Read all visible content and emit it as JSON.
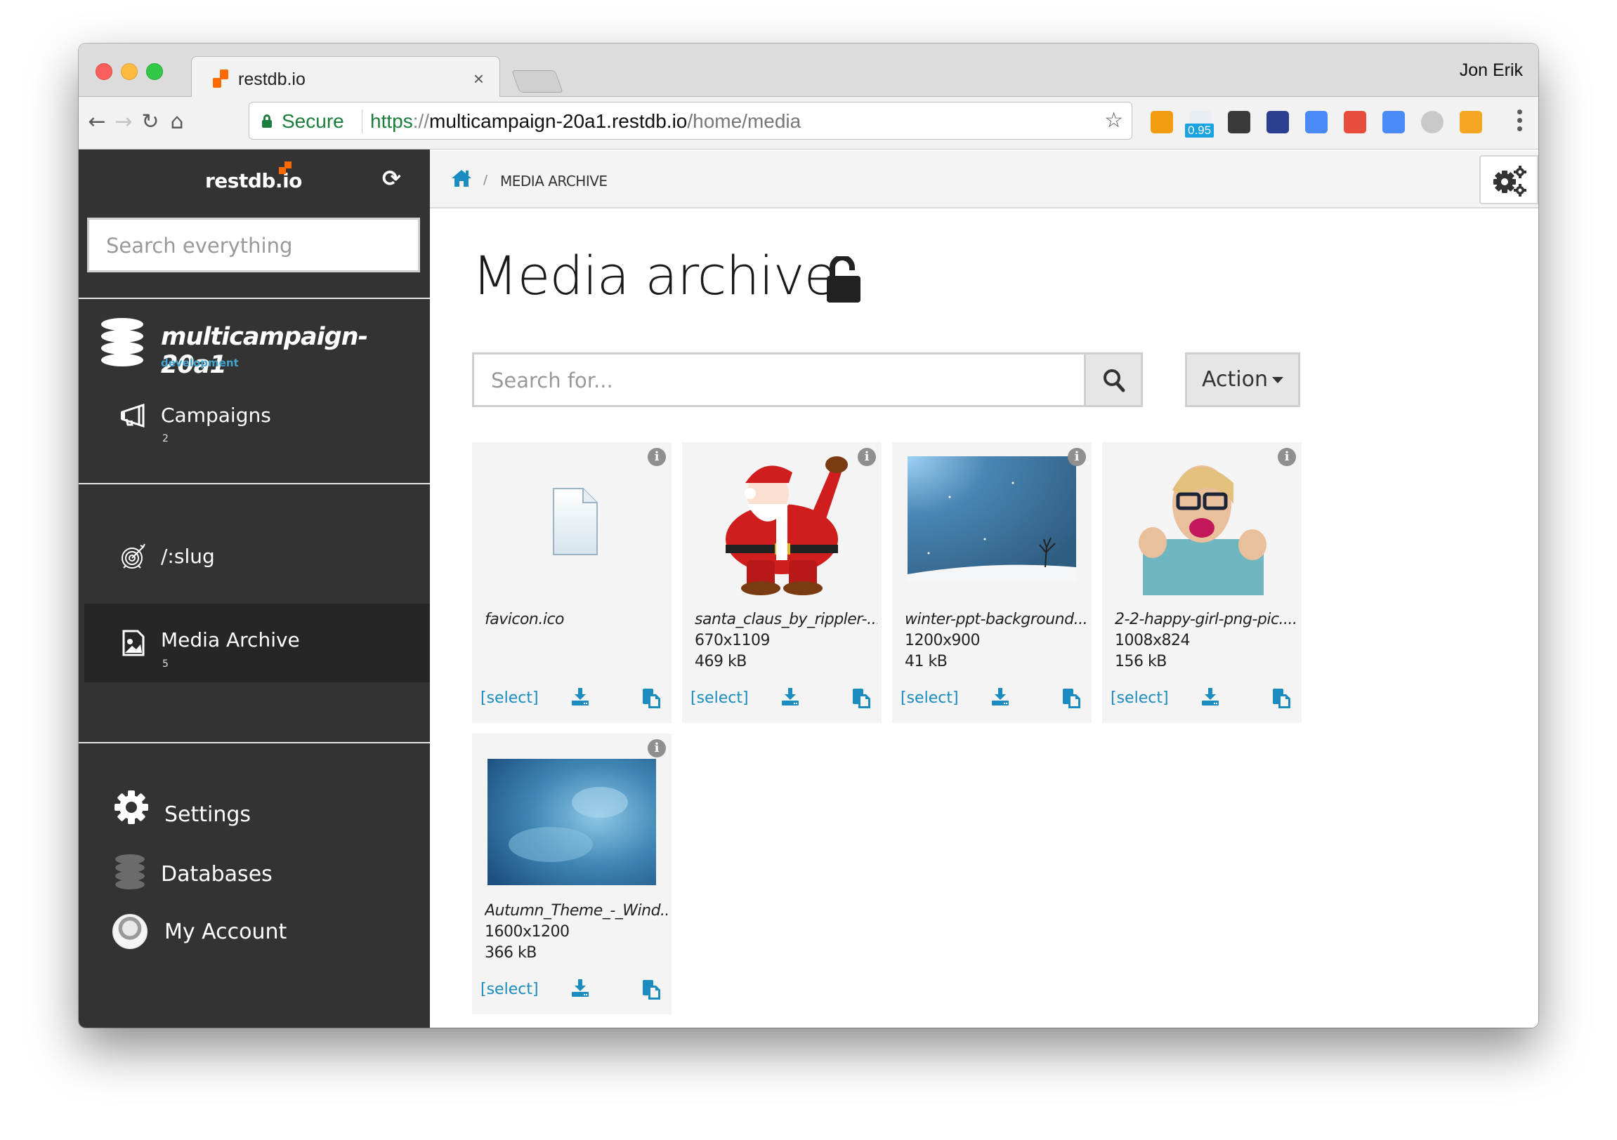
{
  "browser": {
    "tab_title": "restdb.io",
    "tab_close": "×",
    "profile_name": "Jon Erik",
    "secure_label": "Secure",
    "url": {
      "scheme": "https",
      "separator": "://",
      "host": "multicampaign-20a1.restdb.io",
      "path": "/home/media"
    },
    "nav": {
      "back": "←",
      "forward": "→",
      "reload": "↻",
      "home": "⌂"
    },
    "star": "☆",
    "extensions": [
      {
        "name": "sq-extension",
        "color": "#f39c12"
      },
      {
        "name": "badge-extension",
        "badge": "0.95",
        "color": "#1aa3e0"
      },
      {
        "name": "evernote-extension",
        "color": "#3a3a3a"
      },
      {
        "name": "speedometer-extension",
        "color": "#2c3e8f"
      },
      {
        "name": "google-translate-extension",
        "color": "#4a8af4"
      },
      {
        "name": "color-picker-extension",
        "color": "#e74c3c"
      },
      {
        "name": "tag-extension",
        "color": "#4a8af4"
      },
      {
        "name": "u-extension",
        "color": "#c8c8c8"
      },
      {
        "name": "share-extension",
        "color": "#f5a623"
      }
    ]
  },
  "sidebar": {
    "logo_text": "restdb.io",
    "search_placeholder": "Search everything",
    "database": {
      "name": "multicampaign-20a1",
      "environment": "development"
    },
    "collections": [
      {
        "label": "Campaigns",
        "count": "2",
        "icon": "megaphone-icon"
      }
    ],
    "pages": [
      {
        "label": "/:slug",
        "icon": "target-icon"
      },
      {
        "label": "Media Archive",
        "count": "5",
        "icon": "image-file-icon",
        "active": true
      }
    ],
    "bottom": [
      {
        "label": "Settings",
        "icon": "gear-icon"
      },
      {
        "label": "Databases",
        "icon": "database-icon"
      },
      {
        "label": "My Account",
        "icon": "avatar"
      }
    ]
  },
  "main": {
    "breadcrumb": {
      "separator": "/",
      "current": "MEDIA ARCHIVE"
    },
    "title": "Media archive",
    "search_placeholder": "Search for...",
    "action_label": "Action",
    "media": [
      {
        "name": "favicon.ico",
        "dimensions": "",
        "size": "",
        "thumb": "generic-file",
        "select": "[select]"
      },
      {
        "name": "santa_claus_by_rippler-...",
        "dimensions": "670x1109",
        "size": "469 kB",
        "thumb": "santa",
        "select": "[select]"
      },
      {
        "name": "winter-ppt-background...",
        "dimensions": "1200x900",
        "size": "41 kB",
        "thumb": "winter",
        "select": "[select]"
      },
      {
        "name": "2-2-happy-girl-png-pic....",
        "dimensions": "1008x824",
        "size": "156 kB",
        "thumb": "girl",
        "select": "[select]"
      },
      {
        "name": "Autumn_Theme_-_Wind...",
        "dimensions": "1600x1200",
        "size": "366 kB",
        "thumb": "sky",
        "select": "[select]"
      }
    ]
  },
  "colors": {
    "sidebar_bg": "#333333",
    "accent_blue": "#1a8cbf",
    "env_blue": "#44a3cc",
    "brand_orange": "#ff6a00",
    "secure_green": "#1c7e3c"
  }
}
